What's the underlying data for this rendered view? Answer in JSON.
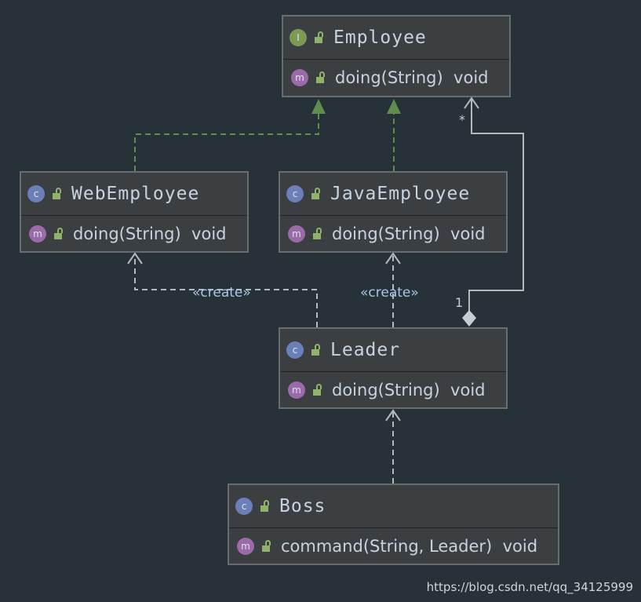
{
  "colors": {
    "background": "#263238",
    "box": "#3c3f41",
    "realization": "#5f8d4e",
    "dependency": "#b5b9bd"
  },
  "classes": [
    {
      "name": "Employee",
      "kind": "interface",
      "badge": "I",
      "method_badge": "m",
      "method": "doing(String)  void"
    },
    {
      "name": "WebEmployee",
      "kind": "class",
      "badge": "c",
      "method_badge": "m",
      "method": "doing(String)  void"
    },
    {
      "name": "JavaEmployee",
      "kind": "class",
      "badge": "c",
      "method_badge": "m",
      "method": "doing(String)  void"
    },
    {
      "name": "Leader",
      "kind": "class",
      "badge": "c",
      "method_badge": "m",
      "method": "doing(String)  void"
    },
    {
      "name": "Boss",
      "kind": "class",
      "badge": "c",
      "method_badge": "m",
      "method": "command(String, Leader)  void"
    }
  ],
  "relations": {
    "create_label_1": "«create»",
    "create_label_2": "«create»",
    "aggregation_many": "*",
    "aggregation_one": "1"
  },
  "watermark": "https://blog.csdn.net/qq_34125999"
}
